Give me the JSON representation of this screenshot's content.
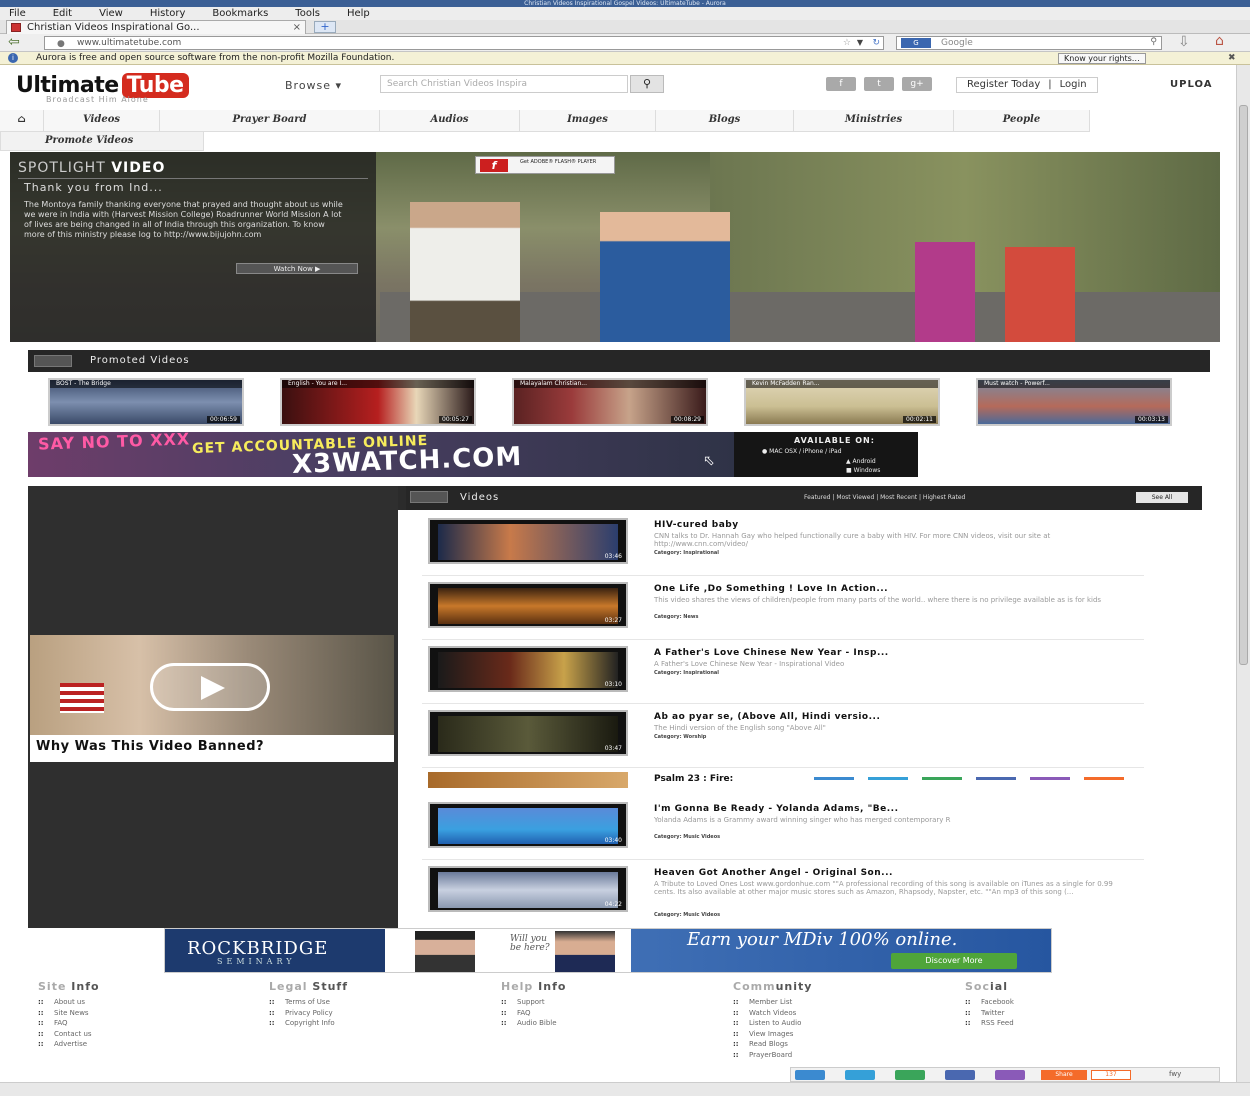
{
  "browser": {
    "window_title": "Christian Videos Inspirational Gospel Videos: UltimateTube - Aurora",
    "menu": [
      "File",
      "Edit",
      "View",
      "History",
      "Bookmarks",
      "Tools",
      "Help"
    ],
    "tab_label": "Christian Videos Inspirational Go...",
    "tab_close": "×",
    "new_tab": "+",
    "url": "www.ultimatetube.com",
    "search_placeholder": "Google",
    "search_engine": "G",
    "infobar_text": "Aurora is free and open source software from the non-profit Mozilla Foundation.",
    "infobar_button": "Know your rights…"
  },
  "header": {
    "logo_part1": "Ultimate",
    "logo_part2": "Tube",
    "tagline": "Broadcast Him Alone",
    "browse_label": "Browse ▾",
    "search_placeholder": "Search Christian Videos Inspira",
    "social": [
      "f",
      "t",
      "g+"
    ],
    "register": "Register Today",
    "separator": "|",
    "login": "Login",
    "upload": "UPLOA"
  },
  "nav": {
    "home_icon": "⌂",
    "items": [
      "Videos",
      "Prayer Board",
      "Audios",
      "Images",
      "Blogs",
      "Ministries",
      "People"
    ],
    "promote": "Promote Videos"
  },
  "spotlight": {
    "heading_light": "SPOTLIGHT",
    "heading_bold": "VIDEO",
    "title": "Thank you from Ind...",
    "description": "The Montoya family thanking everyone that prayed and thought about us while we were in India with (Harvest Mission College) Roadrunner World Mission A lot of lives are being changed in all of India through this organization. To know more of this ministry please log to http://www.bijujohn.com",
    "watch_now": "Watch Now ▶",
    "flash_text": "Get ADOBE® FLASH® PLAYER"
  },
  "promoted": {
    "title": "Promoted Videos",
    "items": [
      {
        "title": "BOST - The Bridge",
        "duration": "00:06:59"
      },
      {
        "title": "English - You are I...",
        "duration": "00:05:27"
      },
      {
        "title": "Malayalam Christian...",
        "duration": "00:08:29"
      },
      {
        "title": "Kevin McFadden Ran...",
        "duration": "00:02:11"
      },
      {
        "title": "Must watch - Powerf...",
        "duration": "00:03:13"
      }
    ]
  },
  "ad_x3": {
    "say": "SAY NO TO XXX",
    "accountable": "GET ACCOUNTABLE ONLINE",
    "url": "X3WATCH.COM",
    "available": "AVAILABLE ON:",
    "platforms": "MAC OSX / iPhone / iPad",
    "android": "Android",
    "windows": "Windows"
  },
  "banned": {
    "title": "Why Was This Video Banned?"
  },
  "videos": {
    "title": "Videos",
    "filters": "Featured | Most Viewed | Most Recent | Highest Rated",
    "see_all": "See All",
    "items": [
      {
        "title": "HIV-cured baby",
        "description": "CNN talks to Dr. Hannah Gay who helped functionally cure a baby with HIV. For more CNN videos, visit our site at http://www.cnn.com/video/",
        "category": "Category: Inspirational",
        "duration": "03:46"
      },
      {
        "title": "One Life ,Do Something ! Love In Action...",
        "description": "This video shares the views of children/people from many parts of the world.. where there is no privilege available as is for kids",
        "category": "Category: News",
        "duration": "03:27"
      },
      {
        "title": "A Father's Love Chinese New Year - Insp...",
        "description": "A Father's Love Chinese New Year - Inspirational Video",
        "category": "Category: Inspirational",
        "duration": "03:10"
      },
      {
        "title": "Ab ao pyar se, (Above All, Hindi versio...",
        "description": "The Hindi version of the English song \"Above All\"",
        "category": "Category: Worship",
        "duration": "03:47"
      },
      {
        "title": "I'm Gonna Be Ready - Yolanda Adams, \"Be...",
        "description": "Yolanda Adams is a Grammy award winning singer who has merged contemporary R",
        "category": "Category: Music Videos",
        "duration": "03:40"
      },
      {
        "title": "Heaven Got Another Angel - Original Son...",
        "description": "A Tribute to Loved Ones Lost www.gordonhue.com \"\"A professional recording of this song is available on iTunes as a single for 0.99 cents. Its also available at other major music stores such as Amazon, Rhapsody, Napster, etc. \"\"An mp3 of this song (...",
        "category": "Category: Music Videos",
        "duration": "04:22"
      }
    ],
    "partial_title": "Psalm 23 : Fire:"
  },
  "ad_rockbridge": {
    "name": "ROCKBRIDGE",
    "sub": "SEMINARY",
    "will": "Will you be here?",
    "earn": "Earn your MDiv 100% online.",
    "discover": "Discover More"
  },
  "footer": {
    "columns": [
      {
        "h1": "Site",
        "h2": "Info",
        "links": [
          "About us",
          "Site News",
          "FAQ",
          "Contact us",
          "Advertise"
        ]
      },
      {
        "h1": "Legal",
        "h2": "Stuff",
        "links": [
          "Terms of Use",
          "Privacy Policy",
          "Copyright Info"
        ]
      },
      {
        "h1": "Help",
        "h2": "Info",
        "links": [
          "Support",
          "FAQ",
          "Audio Bible"
        ]
      },
      {
        "h1": "Comm",
        "h2": "unity",
        "links": [
          "Member List",
          "Watch Videos",
          "Listen to Audio",
          "View Images",
          "Read Blogs",
          "PrayerBoard"
        ]
      },
      {
        "h1": "Soc",
        "h2": "ial",
        "links": [
          "Facebook",
          "Twitter",
          "RSS Feed"
        ]
      }
    ]
  },
  "sharebar": {
    "share": "Share",
    "count": "137",
    "fwy": "fwy"
  },
  "colors": {
    "brand_red": "#d42b1e",
    "dark_bar": "#262626",
    "share_orange": "#f46b2a"
  },
  "icons": {
    "back": "back-arrow-icon",
    "reload": "reload-icon",
    "search": "magnifier-icon",
    "home": "home-icon",
    "info": "info-icon",
    "close": "close-icon"
  }
}
